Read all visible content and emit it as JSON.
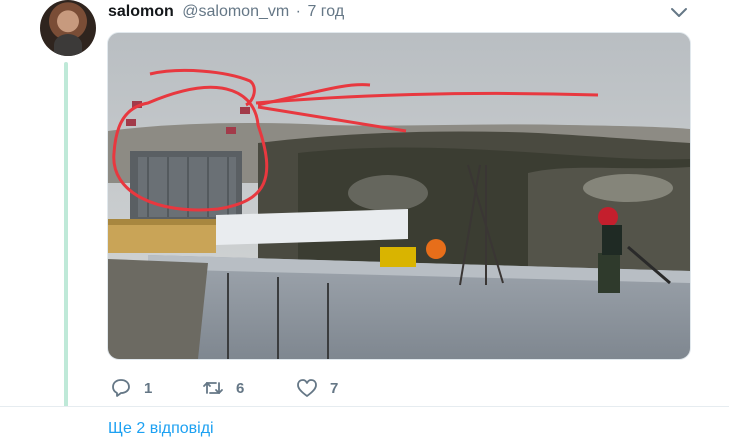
{
  "tweet": {
    "author_name": "salomon",
    "author_handle": "@salomon_vm",
    "separator": "·",
    "time": "7 год",
    "actions": {
      "replies": "1",
      "retweets": "6",
      "likes": "7"
    }
  },
  "more_replies": "Ще 2 відповіді",
  "icons": [
    "avatar",
    "chevron-down-icon",
    "reply-icon",
    "retweet-icon",
    "heart-icon"
  ],
  "colors": {
    "link": "#1da1f2",
    "thread_line": "#bfe9d8",
    "muted": "#657786",
    "annotation": "#e8383f"
  }
}
